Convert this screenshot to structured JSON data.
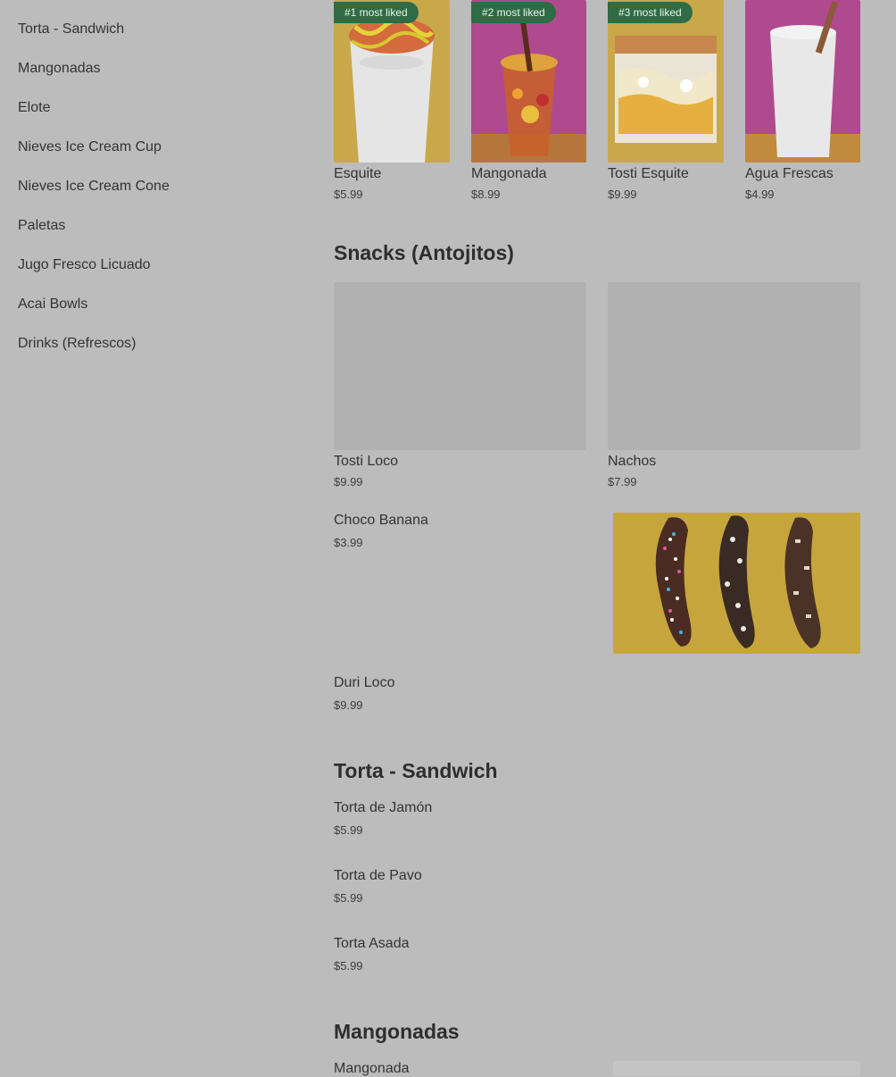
{
  "sidebar": {
    "items": [
      {
        "label": "Torta - Sandwich"
      },
      {
        "label": "Mangonadas"
      },
      {
        "label": "Elote"
      },
      {
        "label": "Nieves Ice Cream Cup"
      },
      {
        "label": "Nieves Ice Cream Cone"
      },
      {
        "label": "Paletas"
      },
      {
        "label": "Jugo Fresco Licuado"
      },
      {
        "label": "Acai Bowls"
      },
      {
        "label": "Drinks (Refrescos)"
      }
    ]
  },
  "popular": {
    "items": [
      {
        "badge": "#1 most liked",
        "name": "Esquite",
        "price": "$5.99"
      },
      {
        "badge": "#2 most liked",
        "name": "Mangonada",
        "price": "$8.99"
      },
      {
        "badge": "#3 most liked",
        "name": "Tosti Esquite",
        "price": "$9.99"
      },
      {
        "badge": "",
        "name": "Agua Frescas",
        "price": "$4.99"
      }
    ]
  },
  "snacks": {
    "title": "Snacks (Antojitos)",
    "grid": [
      {
        "name": "Tosti Loco",
        "price": "$9.99"
      },
      {
        "name": "Nachos",
        "price": "$7.99"
      }
    ],
    "list": [
      {
        "name": "Choco Banana",
        "price": "$3.99"
      },
      {
        "name": "Duri Loco",
        "price": "$9.99"
      }
    ]
  },
  "torta": {
    "title": "Torta - Sandwich",
    "items": [
      {
        "name": "Torta de Jamón",
        "price": "$5.99"
      },
      {
        "name": "Torta de Pavo",
        "price": "$5.99"
      },
      {
        "name": "Torta Asada",
        "price": "$5.99"
      }
    ]
  },
  "mangonadas": {
    "title": "Mangonadas",
    "items": [
      {
        "name": "Mangonada"
      }
    ]
  },
  "colors": {
    "overlay_bg": "#bcbcbc",
    "badge_bg": "#2f6b45"
  }
}
